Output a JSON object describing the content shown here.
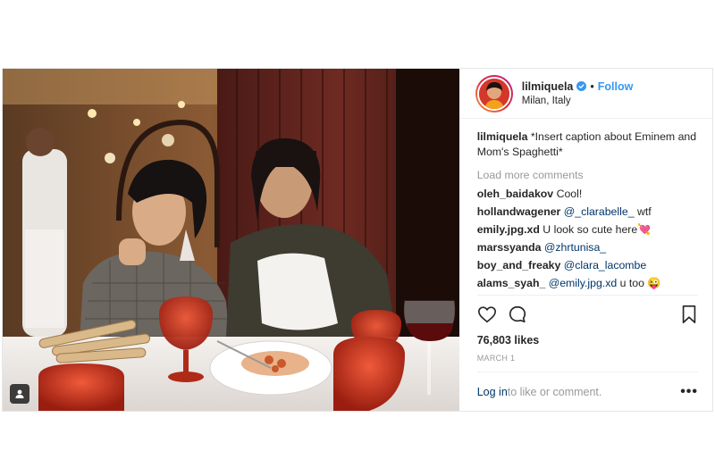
{
  "post": {
    "username": "lilmiquela",
    "follow_label": "Follow",
    "dot": "•",
    "location": "Milan, Italy",
    "caption": {
      "user": "lilmiquela",
      "text": " *Insert caption about Eminem and Mom's Spaghetti*"
    },
    "load_more": "Load more comments",
    "comments": [
      {
        "user": "oleh_baidakov",
        "mention": "",
        "text": " Cool!"
      },
      {
        "user": "hollandwagener",
        "mention": " @_clarabelle_",
        "text": " wtf"
      },
      {
        "user": "emily.jpg.xd",
        "mention": "",
        "text": " U look so cute here💘"
      },
      {
        "user": "marssyanda",
        "mention": " @zhrtunisa_",
        "text": ""
      },
      {
        "user": "boy_and_freaky",
        "mention": " @clara_lacombe",
        "text": ""
      },
      {
        "user": "alams_syah_",
        "mention": " @emily.jpg.xd",
        "text": " u too 😜"
      }
    ],
    "likes": "76,803 likes",
    "date": "MARCH 1",
    "login_link": "Log in",
    "login_rest": " to like or comment.",
    "more": "•••"
  },
  "icons": {
    "like": "heart-icon",
    "comment": "comment-icon",
    "save": "bookmark-icon",
    "verified": "verified-badge-icon",
    "tag": "user-tag-icon"
  },
  "colors": {
    "link": "#3897f0",
    "mention": "#003569",
    "muted": "#999999",
    "text": "#262626"
  }
}
